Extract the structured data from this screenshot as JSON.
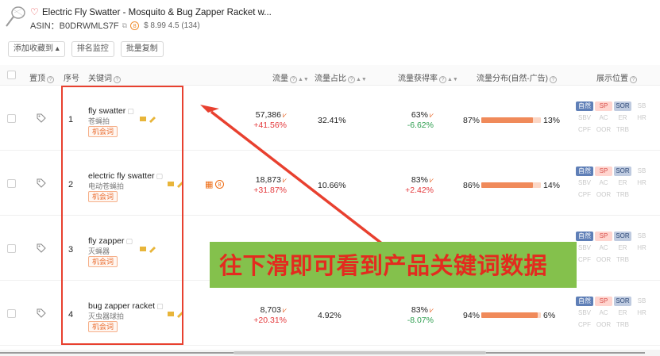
{
  "product": {
    "title": "Electric Fly Swatter - Mosquito & Bug Zapper Racket w...",
    "asin_label": "ASIN：B0DRWMLS7F",
    "price_rating": "$ 8.99 4.5 (134)",
    "badge": "8"
  },
  "toolbar": {
    "add_favorites": "添加收藏到 ▴",
    "rank_monitor": "排名监控",
    "batch_copy": "批量复制"
  },
  "columns": {
    "pin": "置顶",
    "seq": "序号",
    "keyword": "关键词",
    "traffic": "流量",
    "traffic_share": "流量占比",
    "traffic_capture": "流量获得率",
    "traffic_dist": "流量分布(自然-广告)",
    "display_pos": "展示位置"
  },
  "rows": [
    {
      "seq": "1",
      "keyword": "fly swatter",
      "sub": "苍蝇拍",
      "tag": "机会词",
      "traffic": "57,386",
      "traffic_change": "+41.56%",
      "share": "32.41%",
      "capture": "63%",
      "capture_change": "-6.62%",
      "natural": "87%",
      "ad": "13%",
      "natural_frac": 0.87
    },
    {
      "seq": "2",
      "keyword": "electric fly swatter",
      "sub": "电动苍蝇拍",
      "tag": "机会词",
      "traffic": "18,873",
      "traffic_change": "+31.87%",
      "share": "10.66%",
      "capture": "83%",
      "capture_change": "+2.42%",
      "natural": "86%",
      "ad": "14%",
      "natural_frac": 0.86,
      "extra_badge": "8"
    },
    {
      "seq": "3",
      "keyword": "fly zapper",
      "sub": "灭蝇器",
      "tag": "机会词"
    },
    {
      "seq": "4",
      "keyword": "bug zapper racket",
      "sub": "灭虫器球拍",
      "tag": "机会词",
      "traffic": "8,703",
      "traffic_change": "+20.31%",
      "share": "4.92%",
      "capture": "83%",
      "capture_change": "-8.07%",
      "natural": "94%",
      "ad": "6%",
      "natural_frac": 0.94
    }
  ],
  "positions": {
    "row1": [
      "自然",
      "SP",
      "SOR",
      "SB",
      "SBV",
      "AC",
      "ER",
      "HR",
      "CPF",
      "OOR",
      "TRB"
    ],
    "active": [
      "自然",
      "SP",
      "SOR"
    ]
  },
  "banner": {
    "text": "往下滑即可看到产品关键词数据"
  },
  "colors": {
    "accent": "#e96b2e",
    "annotation_red": "#e8402f",
    "banner_green": "#84c14c"
  }
}
